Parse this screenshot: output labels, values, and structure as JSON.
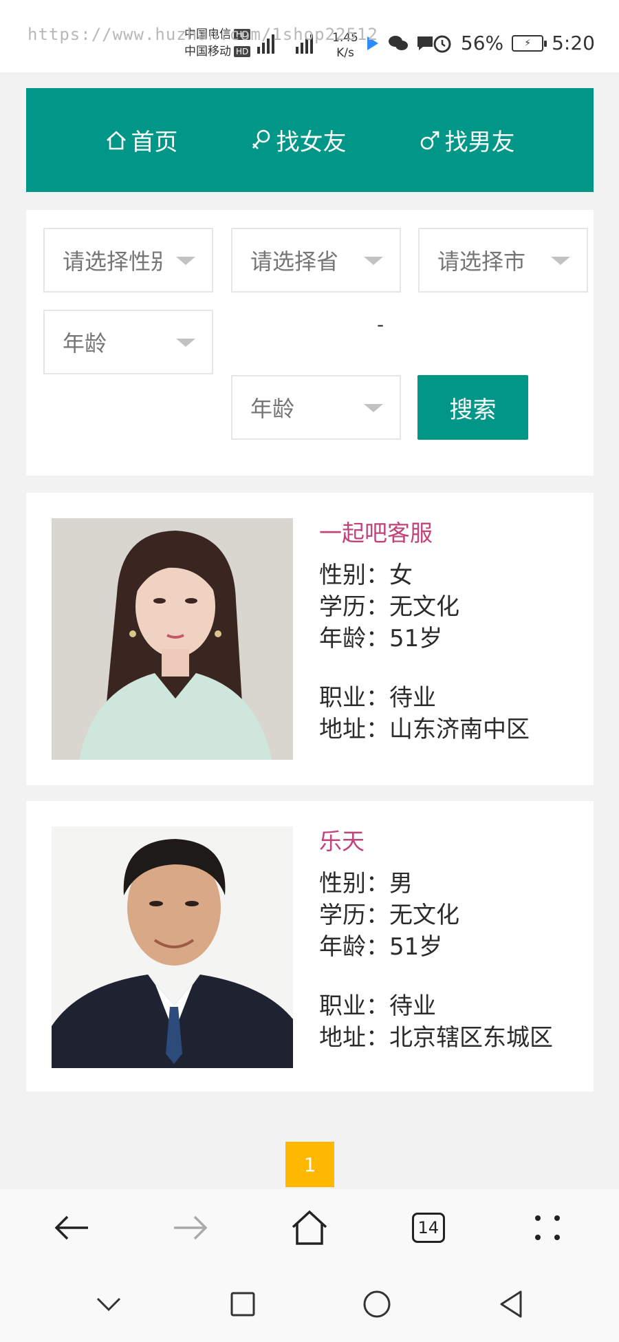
{
  "status_bar": {
    "watermark": "https://www.huzhan.com/1shop22512",
    "carrier1": "中国电信",
    "carrier2": "中国移动",
    "hd": "HD",
    "net_type": "4G",
    "speed_value": "1.45",
    "speed_unit": "K/s",
    "battery_percent": "56%",
    "time": "5:20"
  },
  "nav": {
    "home": "首页",
    "find_girlfriend": "找女友",
    "find_boyfriend": "找男友"
  },
  "search": {
    "gender_placeholder": "请选择性别",
    "province_placeholder": "请选择省",
    "city_placeholder": "请选择市",
    "age_min_placeholder": "年龄",
    "age_separator": "-",
    "age_max_placeholder": "年龄",
    "search_button": "搜索"
  },
  "profiles": [
    {
      "name": "一起吧客服",
      "gender": "性别：女",
      "education": "学历：无文化",
      "age": "年龄：51岁",
      "occupation": "职业：待业",
      "address": "地址：山东济南中区"
    },
    {
      "name": "乐天",
      "gender": "性别：男",
      "education": "学历：无文化",
      "age": "年龄：51岁",
      "occupation": "职业：待业",
      "address": "地址：北京辖区东城区"
    }
  ],
  "pagination": {
    "current_page": "1"
  },
  "browser_toolbar": {
    "tab_count": "14"
  },
  "colors": {
    "primary": "#009688",
    "name_pink": "#c2437b",
    "page_active": "#ffb800"
  }
}
